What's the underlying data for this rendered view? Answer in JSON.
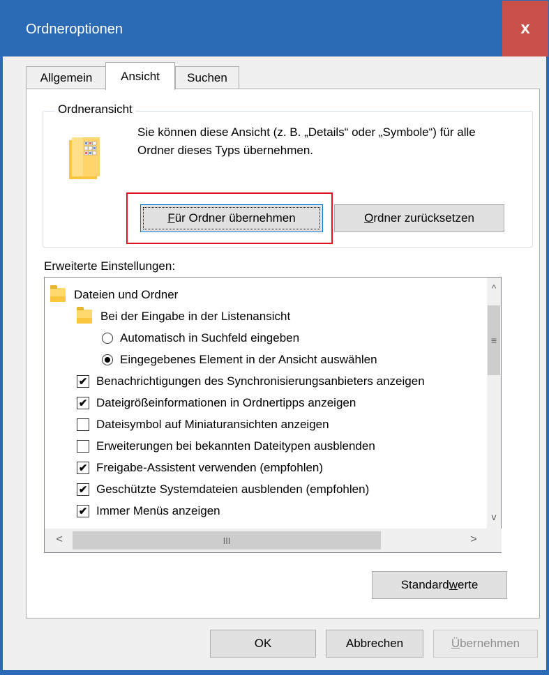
{
  "window": {
    "title": "Ordneroptionen",
    "close_glyph": "x",
    "close_color": "#c9514a",
    "accent": "#2b6bb5"
  },
  "tabs": [
    {
      "label": "Allgemein",
      "active": false
    },
    {
      "label": "Ansicht",
      "active": true
    },
    {
      "label": "Suchen",
      "active": false
    }
  ],
  "folder_view": {
    "group_label": "Ordneransicht",
    "description": "Sie können diese Ansicht (z. B. „Details“ oder „Symbole“) für alle Ordner dieses Typs übernehmen.",
    "apply_button": {
      "mnemonic": "F",
      "rest": "ür Ordner übernehmen"
    },
    "reset_button": {
      "mnemonic": "O",
      "rest": "rdner zurücksetzen"
    }
  },
  "advanced": {
    "label": "Erweiterte Einstellungen:",
    "items": [
      {
        "type": "folder",
        "indent": 0,
        "label": "Dateien und Ordner"
      },
      {
        "type": "folder",
        "indent": 1,
        "label": "Bei der Eingabe in der Listenansicht"
      },
      {
        "type": "radio",
        "indent": 2,
        "checked": false,
        "label": "Automatisch in Suchfeld eingeben"
      },
      {
        "type": "radio",
        "indent": 2,
        "checked": true,
        "label": "Eingegebenes Element in der Ansicht auswählen"
      },
      {
        "type": "check",
        "indent": 1,
        "checked": true,
        "label": "Benachrichtigungen des Synchronisierungsanbieters anzeigen"
      },
      {
        "type": "check",
        "indent": 1,
        "checked": true,
        "label": "Dateigrößeinformationen in Ordnertipps anzeigen"
      },
      {
        "type": "check",
        "indent": 1,
        "checked": false,
        "label": "Dateisymbol auf Miniaturansichten anzeigen"
      },
      {
        "type": "check",
        "indent": 1,
        "checked": false,
        "label": "Erweiterungen bei bekannten Dateitypen ausblenden"
      },
      {
        "type": "check",
        "indent": 1,
        "checked": true,
        "label": "Freigabe-Assistent verwenden (empfohlen)"
      },
      {
        "type": "check",
        "indent": 1,
        "checked": true,
        "label": "Geschützte Systemdateien ausblenden (empfohlen)"
      },
      {
        "type": "check",
        "indent": 1,
        "checked": true,
        "label": "Immer Menüs anzeigen"
      }
    ],
    "scroll": {
      "up": "^",
      "down": "v",
      "left": "<",
      "right": ">",
      "grip_v": "≡",
      "grip_h": "III"
    }
  },
  "defaults_button": {
    "before": "Standard",
    "mnemonic": "w",
    "after": "erte"
  },
  "footer": {
    "ok": "OK",
    "cancel": "Abbrechen",
    "apply": {
      "mnemonic": "Ü",
      "rest": "bernehmen",
      "disabled": true
    }
  }
}
